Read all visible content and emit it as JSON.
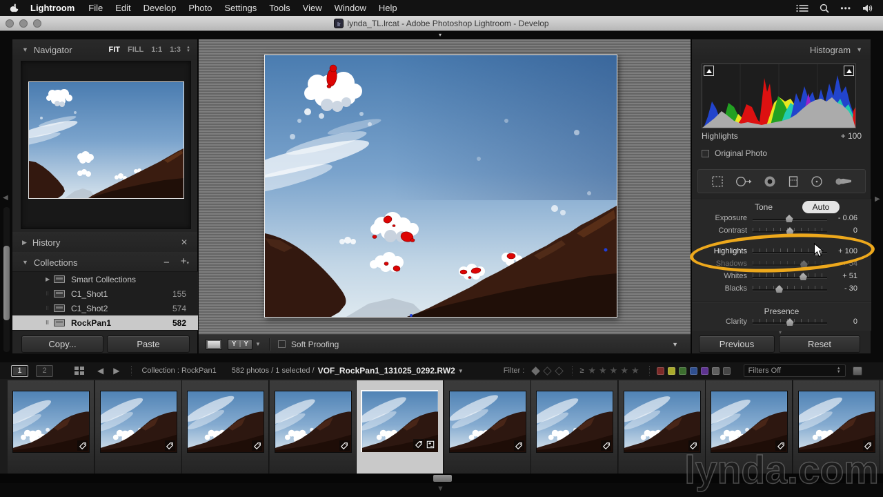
{
  "menu_bar": {
    "items": [
      "Lightroom",
      "File",
      "Edit",
      "Develop",
      "Photo",
      "Settings",
      "Tools",
      "View",
      "Window",
      "Help"
    ]
  },
  "title_bar": {
    "title": "lynda_TL.lrcat - Adobe Photoshop Lightroom - Develop",
    "app_icon_label": "lr"
  },
  "left_panel": {
    "navigator": {
      "title": "Navigator",
      "zoom_modes": [
        {
          "label": "FIT",
          "active": true
        },
        {
          "label": "FILL",
          "active": false
        },
        {
          "label": "1:1",
          "active": false
        },
        {
          "label": "1:3",
          "active": false
        }
      ]
    },
    "history": {
      "title": "History"
    },
    "collections": {
      "title": "Collections",
      "items": [
        {
          "label": "Smart Collections",
          "count": "",
          "selected": false,
          "smart": true
        },
        {
          "label": "C1_Shot1",
          "count": "155",
          "selected": false,
          "smart": false
        },
        {
          "label": "C1_Shot2",
          "count": "574",
          "selected": false,
          "smart": false
        },
        {
          "label": "RockPan1",
          "count": "582",
          "selected": true,
          "smart": false
        }
      ]
    },
    "copy_button": "Copy...",
    "paste_button": "Paste"
  },
  "toolbar": {
    "yy_label": "Y Y",
    "soft_proofing_label": "Soft Proofing"
  },
  "right_panel": {
    "histogram": {
      "title": "Histogram",
      "readout_label": "Highlights",
      "readout_value": "+ 100",
      "original_photo_label": "Original Photo"
    },
    "tone": {
      "title": "Tone",
      "auto_button": "Auto",
      "sliders": [
        {
          "label": "Exposure",
          "value": "- 0.06",
          "pos": 0.49,
          "ticks": false,
          "active": false,
          "dimmed": false
        },
        {
          "label": "Contrast",
          "value": "0",
          "pos": 0.5,
          "ticks": true,
          "active": false,
          "dimmed": false
        },
        {
          "label": "Highlights",
          "value": "+ 100",
          "pos": 0.92,
          "ticks": true,
          "active": true,
          "dimmed": false
        },
        {
          "label": "Shadows",
          "value": "+ 54",
          "pos": 0.71,
          "ticks": true,
          "active": false,
          "dimmed": true
        },
        {
          "label": "Whites",
          "value": "+ 51",
          "pos": 0.7,
          "ticks": true,
          "active": false,
          "dimmed": false
        },
        {
          "label": "Blacks",
          "value": "- 30",
          "pos": 0.34,
          "ticks": true,
          "active": false,
          "dimmed": false
        }
      ]
    },
    "presence": {
      "title": "Presence",
      "sliders": [
        {
          "label": "Clarity",
          "value": "0",
          "pos": 0.5,
          "ticks": true,
          "active": false,
          "dimmed": false
        }
      ]
    },
    "previous_button": "Previous",
    "reset_button": "Reset"
  },
  "filmstrip_bar": {
    "window_buttons": [
      "1",
      "2"
    ],
    "collection_label": "Collection : RockPan1",
    "selection_info": "582 photos / 1 selected /",
    "filename": "VOF_RockPan1_131025_0292.RW2",
    "filter_label": "Filter :",
    "rating_operator": "≥",
    "star_count": 5,
    "label_colors": [
      "#7c2a28",
      "#a9a92b",
      "#3c6e2f",
      "#2f4f8f",
      "#5d3390",
      "#5f5f5f",
      "#464646"
    ],
    "filters_dropdown": "Filters Off"
  },
  "filmstrip": {
    "thumb_count": 11,
    "selected_index": 4
  },
  "watermark": "lynda.com"
}
